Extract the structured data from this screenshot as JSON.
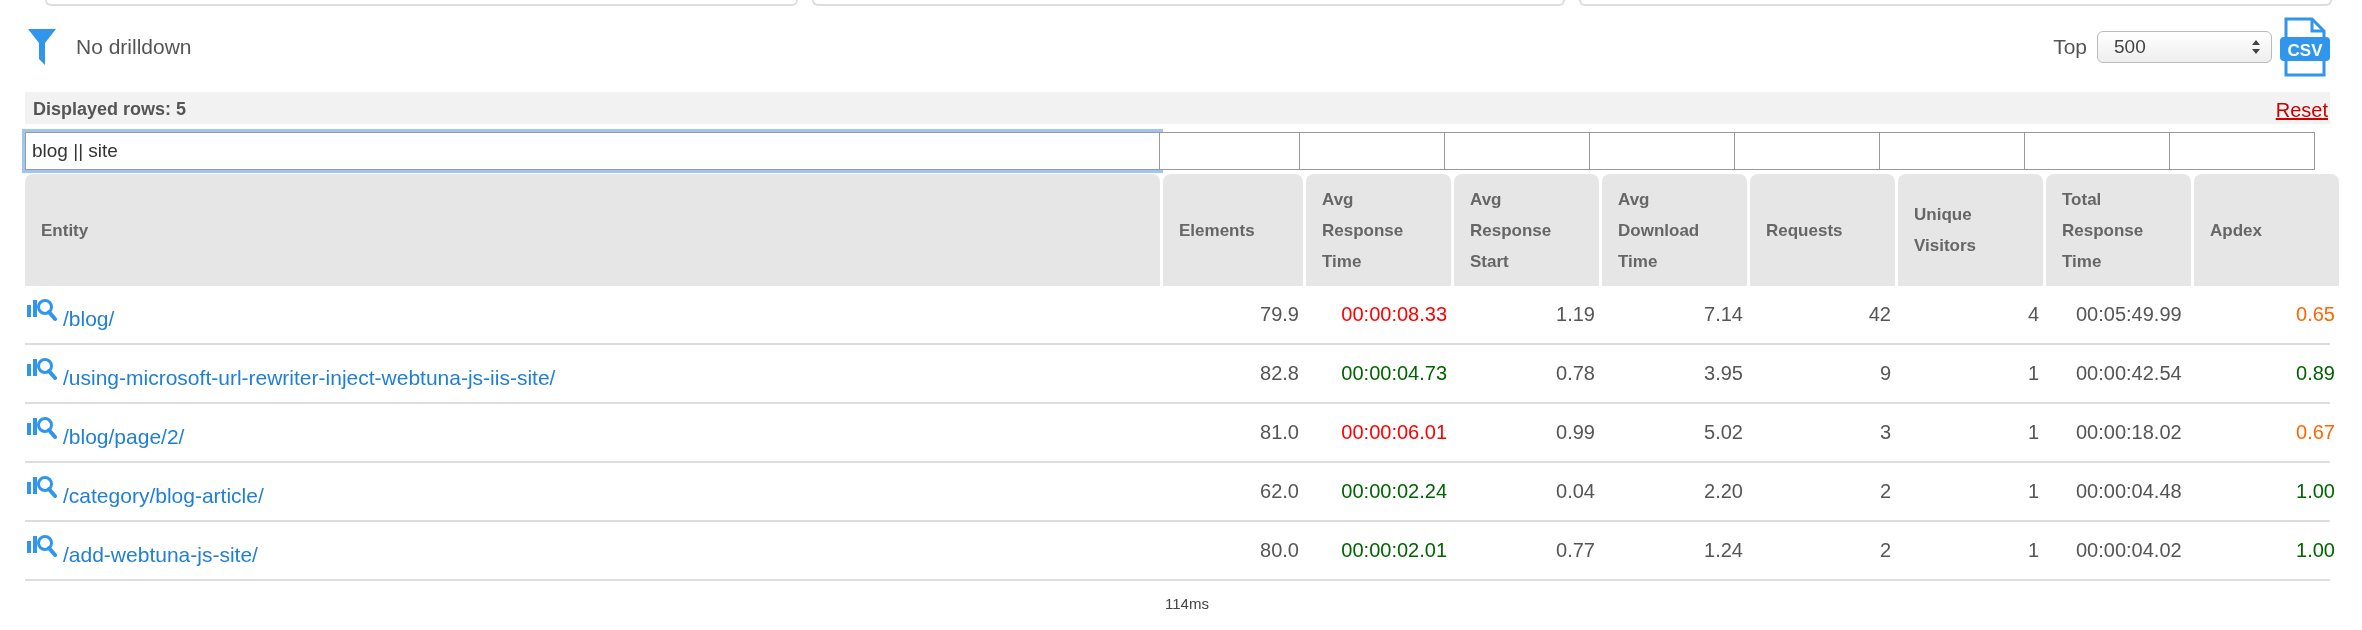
{
  "drilldown": {
    "label": "No drilldown"
  },
  "top": {
    "label": "Top",
    "value": "500"
  },
  "export": {
    "label": "CSV"
  },
  "table": {
    "displayed_rows": "Displayed rows: 5",
    "reset": "Reset",
    "filters": [
      {
        "value": "blog || site"
      }
    ],
    "columns": [
      "Entity",
      "Elements",
      "Avg Response Time",
      "Avg Response Start",
      "Avg Download Time",
      "Requests",
      "Unique Visitors",
      "Total Response Time",
      "Apdex"
    ],
    "rows": [
      {
        "cells": [
          {
            "text": "/blog/",
            "kind": "link"
          },
          {
            "text": "79.9"
          },
          {
            "text": "00:00:08.33",
            "color": "#ff0000"
          },
          {
            "text": "1.19"
          },
          {
            "text": "7.14"
          },
          {
            "text": "42"
          },
          {
            "text": "4"
          },
          {
            "text": "00:05:49.99"
          },
          {
            "text": "0.65",
            "color": "#ff6600"
          }
        ]
      },
      {
        "cells": [
          {
            "text": "/using-microsoft-url-rewriter-inject-webtuna-js-iis-site/",
            "kind": "link"
          },
          {
            "text": "82.8"
          },
          {
            "text": "00:00:04.73",
            "color": "#006400"
          },
          {
            "text": "0.78"
          },
          {
            "text": "3.95"
          },
          {
            "text": "9"
          },
          {
            "text": "1"
          },
          {
            "text": "00:00:42.54"
          },
          {
            "text": "0.89",
            "color": "#006400"
          }
        ]
      },
      {
        "cells": [
          {
            "text": "/blog/page/2/",
            "kind": "link"
          },
          {
            "text": "81.0"
          },
          {
            "text": "00:00:06.01",
            "color": "#ff0000"
          },
          {
            "text": "0.99"
          },
          {
            "text": "5.02"
          },
          {
            "text": "3"
          },
          {
            "text": "1"
          },
          {
            "text": "00:00:18.02"
          },
          {
            "text": "0.67",
            "color": "#ff6600"
          }
        ]
      },
      {
        "cells": [
          {
            "text": "/category/blog-article/",
            "kind": "link"
          },
          {
            "text": "62.0"
          },
          {
            "text": "00:00:02.24",
            "color": "#006400"
          },
          {
            "text": "0.04"
          },
          {
            "text": "2.20"
          },
          {
            "text": "2"
          },
          {
            "text": "1"
          },
          {
            "text": "00:00:04.48"
          },
          {
            "text": "1.00",
            "color": "#006400"
          }
        ]
      },
      {
        "cells": [
          {
            "text": "/add-webtuna-js-site/",
            "kind": "link"
          },
          {
            "text": "80.0"
          },
          {
            "text": "00:00:02.01",
            "color": "#006400"
          },
          {
            "text": "0.77"
          },
          {
            "text": "1.24"
          },
          {
            "text": "2"
          },
          {
            "text": "1"
          },
          {
            "text": "00:00:04.02"
          },
          {
            "text": "1.00",
            "color": "#006400"
          }
        ]
      }
    ]
  },
  "footer": {
    "timing": "114ms"
  }
}
